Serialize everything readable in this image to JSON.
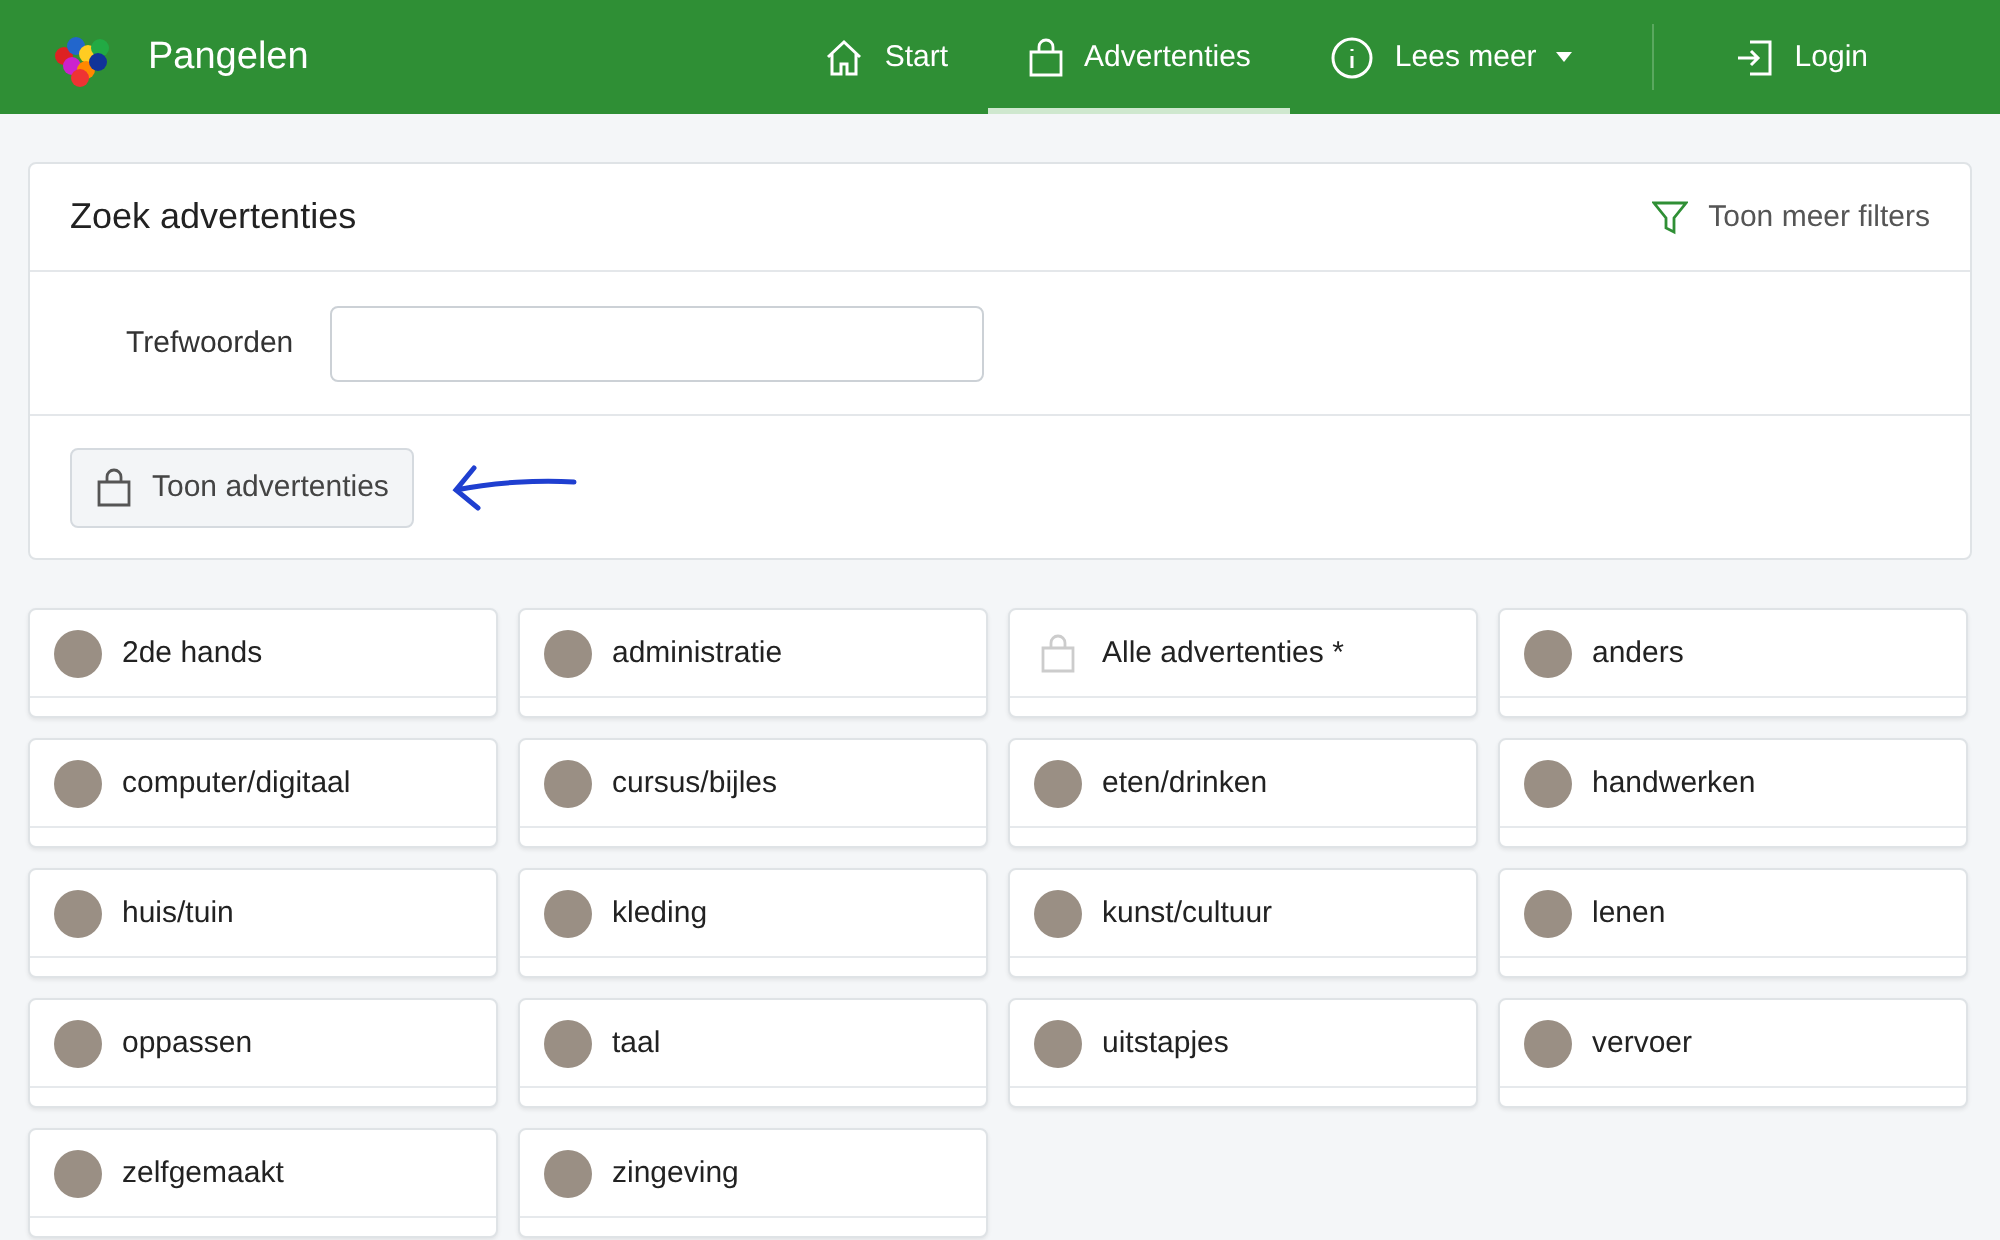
{
  "brand": {
    "name": "Pangelen"
  },
  "nav": [
    {
      "label": "Start",
      "kind": "home",
      "selected": false
    },
    {
      "label": "Advertenties",
      "kind": "bag",
      "selected": true
    },
    {
      "label": "Lees meer",
      "kind": "info",
      "selected": false,
      "dropdown": true
    }
  ],
  "login": {
    "label": "Login"
  },
  "search": {
    "title": "Zoek advertenties",
    "filters_link": "Toon meer filters",
    "keywords_label": "Trefwoorden",
    "submit": "Toon advertenties"
  },
  "categories": [
    {
      "label": "2de hands",
      "kind": "photo"
    },
    {
      "label": "administratie",
      "kind": "photo"
    },
    {
      "label": "Alle advertenties *",
      "kind": "icon"
    },
    {
      "label": "anders",
      "kind": "photo"
    },
    {
      "label": "computer/digitaal",
      "kind": "photo"
    },
    {
      "label": "cursus/bijles",
      "kind": "photo"
    },
    {
      "label": "eten/drinken",
      "kind": "photo"
    },
    {
      "label": "handwerken",
      "kind": "photo"
    },
    {
      "label": "huis/tuin",
      "kind": "photo"
    },
    {
      "label": "kleding",
      "kind": "photo"
    },
    {
      "label": "kunst/cultuur",
      "kind": "photo"
    },
    {
      "label": "lenen",
      "kind": "photo"
    },
    {
      "label": "oppassen",
      "kind": "photo"
    },
    {
      "label": "taal",
      "kind": "photo"
    },
    {
      "label": "uitstapjes",
      "kind": "photo"
    },
    {
      "label": "vervoer",
      "kind": "photo"
    },
    {
      "label": "zelfgemaakt",
      "kind": "photo"
    },
    {
      "label": "zingeving",
      "kind": "photo"
    }
  ]
}
